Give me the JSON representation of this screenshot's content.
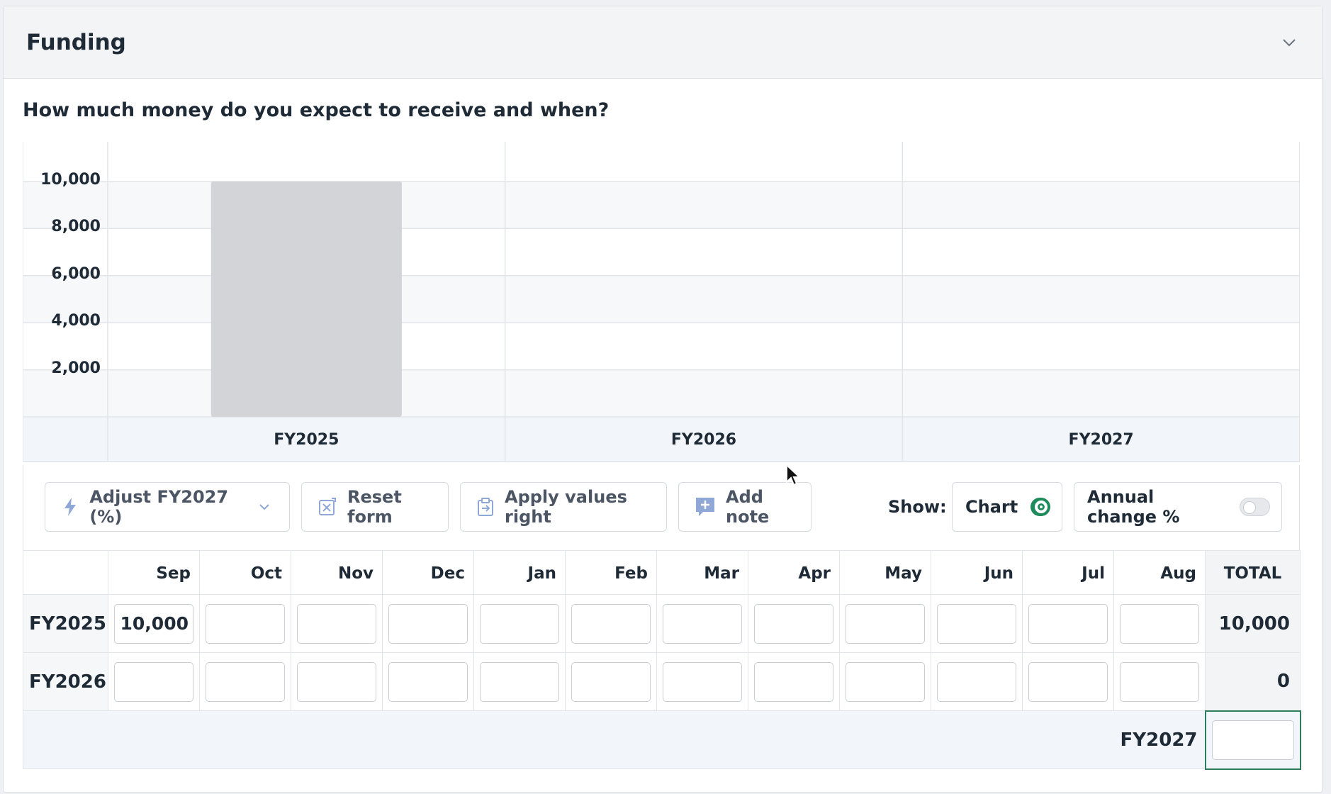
{
  "panel": {
    "title": "Funding",
    "collapse_icon": "chevron-down-icon"
  },
  "question": "How much money do you expect to receive and when?",
  "chart_data": {
    "type": "bar",
    "categories": [
      "FY2025",
      "FY2026",
      "FY2027"
    ],
    "values": [
      10000,
      0,
      0
    ],
    "yticks": [
      "10,000",
      "8,000",
      "6,000",
      "4,000",
      "2,000"
    ],
    "ylim": [
      0,
      10000
    ],
    "bar_color": "#d3d4d7",
    "grid": true
  },
  "toolbar": {
    "adjust_label": "Adjust FY2027 (%)",
    "reset_label": "Reset form",
    "apply_label": "Apply values right",
    "note_label": "Add note",
    "show_label": "Show:",
    "chart_toggle_label": "Chart",
    "chart_toggle_on": true,
    "annual_change_label": "Annual change %",
    "annual_change_on": false
  },
  "table": {
    "months": [
      "Sep",
      "Oct",
      "Nov",
      "Dec",
      "Jan",
      "Feb",
      "Mar",
      "Apr",
      "May",
      "Jun",
      "Jul",
      "Aug"
    ],
    "total_header": "TOTAL",
    "rows": [
      {
        "label": "FY2025",
        "values": [
          "10,000",
          "",
          "",
          "",
          "",
          "",
          "",
          "",
          "",
          "",
          "",
          ""
        ],
        "total": "10,000"
      },
      {
        "label": "FY2026",
        "values": [
          "",
          "",
          "",
          "",
          "",
          "",
          "",
          "",
          "",
          "",
          "",
          ""
        ],
        "total": "0"
      }
    ],
    "fy27_label": "FY2027",
    "fy27_value": ""
  },
  "colors": {
    "accent_green": "#1f8a5b",
    "focus_border": "#2e7d5a"
  }
}
